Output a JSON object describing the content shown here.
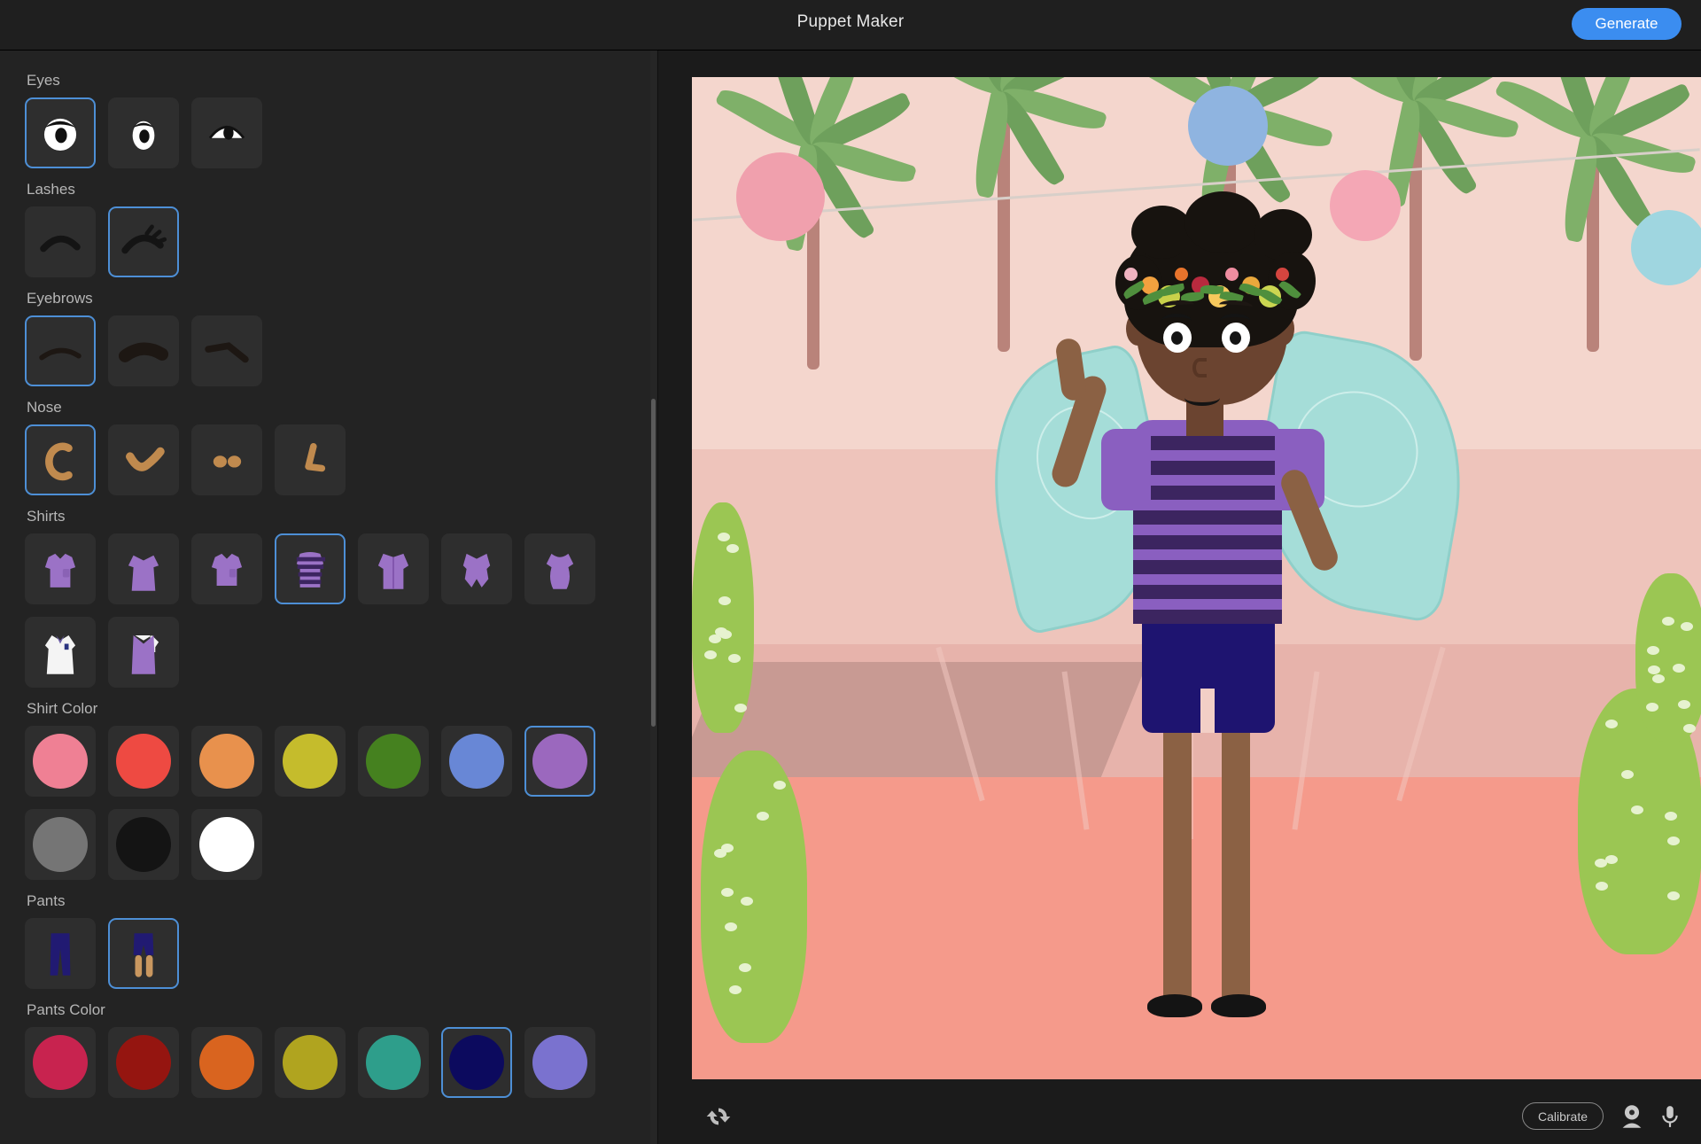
{
  "header": {
    "title": "Puppet Maker",
    "generate_label": "Generate",
    "accent_color": "#3b8df0"
  },
  "sidebar": {
    "sections": [
      {
        "label": "Eyes",
        "type": "thumbs",
        "name": "eyes",
        "selected": 0,
        "options": [
          {
            "name": "eye-round-large"
          },
          {
            "name": "eye-oval-small"
          },
          {
            "name": "eye-half-dome"
          }
        ]
      },
      {
        "label": "Lashes",
        "type": "thumbs",
        "name": "lashes",
        "selected": 1,
        "options": [
          {
            "name": "lash-plain-arc"
          },
          {
            "name": "lash-spiky"
          }
        ]
      },
      {
        "label": "Eyebrows",
        "type": "thumbs",
        "name": "eyebrows",
        "selected": 0,
        "options": [
          {
            "name": "brow-thin-arc"
          },
          {
            "name": "brow-thick-bushy"
          },
          {
            "name": "brow-angled"
          }
        ]
      },
      {
        "label": "Nose",
        "type": "thumbs",
        "name": "nose",
        "selected": 0,
        "options": [
          {
            "name": "nose-c-curve"
          },
          {
            "name": "nose-check-mark"
          },
          {
            "name": "nose-two-nostrils"
          },
          {
            "name": "nose-l-shape"
          }
        ]
      },
      {
        "label": "Shirts",
        "type": "thumbs",
        "name": "shirts",
        "selected": 3,
        "options": [
          {
            "name": "shirt-polo"
          },
          {
            "name": "shirt-long-dress"
          },
          {
            "name": "shirt-pocket-tee"
          },
          {
            "name": "shirt-striped-tee"
          },
          {
            "name": "shirt-button-down"
          },
          {
            "name": "shirt-tank-frill"
          },
          {
            "name": "shirt-blouse"
          },
          {
            "name": "shirt-lab-coat"
          },
          {
            "name": "shirt-vest"
          }
        ]
      },
      {
        "label": "Shirt Color",
        "type": "swatches",
        "name": "shirt-color",
        "selected": 6,
        "options": [
          {
            "name": "swatch-pink",
            "color": "#ef8094"
          },
          {
            "name": "swatch-red",
            "color": "#ee4a42"
          },
          {
            "name": "swatch-orange",
            "color": "#e8914d"
          },
          {
            "name": "swatch-yellow",
            "color": "#c5bc2c"
          },
          {
            "name": "swatch-green",
            "color": "#45811f"
          },
          {
            "name": "swatch-blue",
            "color": "#6887d6"
          },
          {
            "name": "swatch-purple",
            "color": "#9b68be"
          },
          {
            "name": "swatch-gray",
            "color": "#757575"
          },
          {
            "name": "swatch-black",
            "color": "#141414"
          },
          {
            "name": "swatch-white",
            "color": "#ffffff"
          }
        ]
      },
      {
        "label": "Pants",
        "type": "thumbs",
        "name": "pants",
        "selected": 1,
        "options": [
          {
            "name": "pants-long-trousers"
          },
          {
            "name": "pants-shorts"
          }
        ]
      },
      {
        "label": "Pants Color",
        "type": "swatches",
        "name": "pants-color",
        "selected": 5,
        "options": [
          {
            "name": "swatch-crimson",
            "color": "#c8234f"
          },
          {
            "name": "swatch-dark-red",
            "color": "#951510"
          },
          {
            "name": "swatch-burnt-orange",
            "color": "#d9641f"
          },
          {
            "name": "swatch-olive",
            "color": "#b0a41f"
          },
          {
            "name": "swatch-teal",
            "color": "#2e9e8b"
          },
          {
            "name": "swatch-navy",
            "color": "#0c0a5e"
          },
          {
            "name": "swatch-periwinkle",
            "color": "#7a72cf"
          }
        ]
      }
    ]
  },
  "bottombar": {
    "reset_icon": "refresh-icon",
    "calibrate_label": "Calibrate",
    "camera_icon": "webcam-icon",
    "mic_icon": "microphone-icon"
  },
  "scene": {
    "description": "Illustrated character preview",
    "character": {
      "skin_color": "#6b4430",
      "hair_color": "#17130f",
      "shirt_color": "#8a5fc0",
      "shirt_stripe_color": "#3c2560",
      "pants_color": "#1e1470",
      "wing_color": "#a5ddd8"
    },
    "background": {
      "sky_color": "#f4d6cd",
      "ground_color": "#f59a8b",
      "palm_color": "#7fb069",
      "cactus_color": "#9bc653"
    }
  }
}
